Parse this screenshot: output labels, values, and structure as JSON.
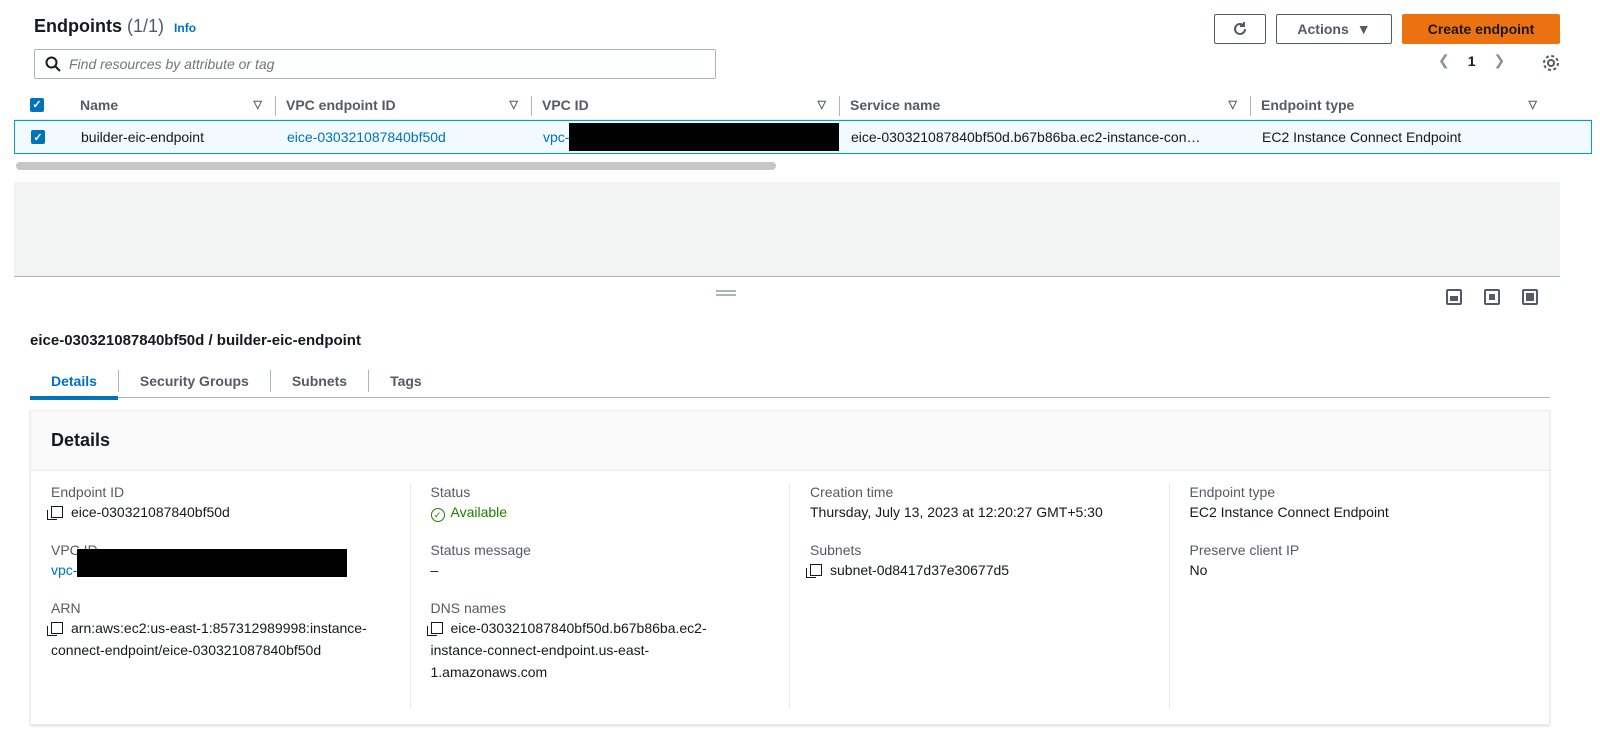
{
  "header": {
    "title": "Endpoints",
    "count": "(1/1)",
    "info": "Info",
    "actions_label": "Actions",
    "create_label": "Create endpoint",
    "search_placeholder": "Find resources by attribute or tag",
    "page_number": "1"
  },
  "table": {
    "columns": [
      "Name",
      "VPC endpoint ID",
      "VPC ID",
      "Service name",
      "Endpoint type"
    ],
    "rows": [
      {
        "name": "builder-eic-endpoint",
        "vpc_endpoint_id": "eice-030321087840bf50d",
        "vpc_id": "vpc-",
        "service_name": "eice-030321087840bf50d.b67b86ba.ec2-instance-con…",
        "endpoint_type": "EC2 Instance Connect Endpoint"
      }
    ]
  },
  "detail": {
    "title": "eice-030321087840bf50d / builder-eic-endpoint",
    "tabs": [
      "Details",
      "Security Groups",
      "Subnets",
      "Tags"
    ],
    "card_title": "Details",
    "fields": {
      "endpoint_id_label": "Endpoint ID",
      "endpoint_id": "eice-030321087840bf50d",
      "vpc_id_label": "VPC ID",
      "vpc_id": "vpc-",
      "arn_label": "ARN",
      "arn_line1": "arn:aws:ec2:us-east-1:857312989998:instance-",
      "arn_line2": "connect-endpoint/eice-030321087840bf50d",
      "status_label": "Status",
      "status": "Available",
      "status_message_label": "Status message",
      "status_message": "–",
      "dns_label": "DNS names",
      "dns_line1": "eice-030321087840bf50d.b67b86ba.ec2-",
      "dns_line2": "instance-connect-endpoint.us-east-",
      "dns_line3": "1.amazonaws.com",
      "creation_label": "Creation time",
      "creation": "Thursday, July 13, 2023 at 12:20:27 GMT+5:30",
      "subnets_label": "Subnets",
      "subnet": "subnet-0d8417d37e30677d5",
      "endpoint_type_label": "Endpoint type",
      "endpoint_type": "EC2 Instance Connect Endpoint",
      "preserve_ip_label": "Preserve client IP",
      "preserve_ip": "No"
    }
  },
  "colors": {
    "link": "#0073bb",
    "primary_button": "#ec7211",
    "success": "#1d8102"
  }
}
